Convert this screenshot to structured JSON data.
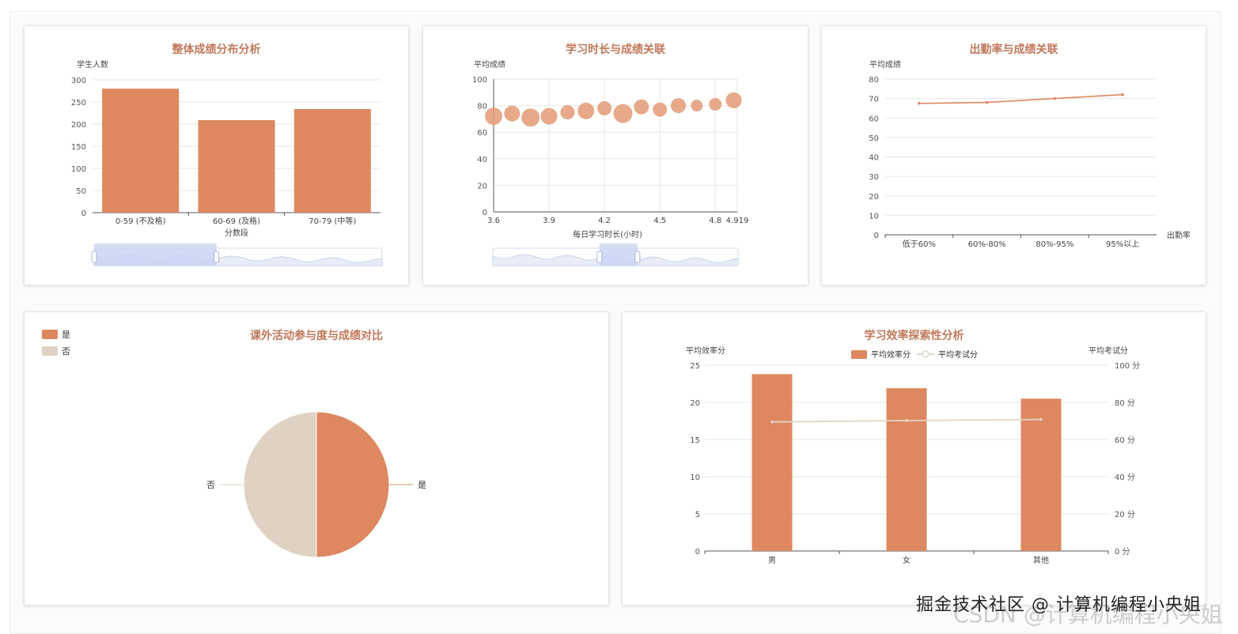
{
  "colors": {
    "bar": "#dd8860",
    "bar_light": "#e39a76",
    "pie_no": "#e0d2c2",
    "title": "#c0785a",
    "line2": "#e3d5c6",
    "axis": "#666666",
    "grid": "#e6e6e6",
    "zoom_fill": "#c9d5f3"
  },
  "chart_data": [
    {
      "id": "score-dist",
      "type": "bar",
      "title": "整体成绩分布分析",
      "xlabel": "分数段",
      "ylabel": "学生人数",
      "categories": [
        "0-59 (不及格)",
        "60-69 (及格)",
        "70-79 (中等)"
      ],
      "values": [
        280,
        209,
        234
      ],
      "ylim": [
        0,
        300
      ],
      "yticks": [
        "0",
        "50",
        "100",
        "150",
        "200",
        "250",
        "300"
      ],
      "grid": true,
      "datazoom": true
    },
    {
      "id": "study-hours",
      "type": "scatter",
      "title": "学习时长与成绩关联",
      "xlabel": "每日学习时长(小时)",
      "ylabel": "平均成绩",
      "xlim": [
        3.6,
        4.919
      ],
      "ylim": [
        0,
        100
      ],
      "xticks": [
        "3.6",
        "3.9",
        "4.2",
        "4.5",
        "4.8",
        "4.919"
      ],
      "yticks": [
        "0",
        "20",
        "40",
        "60",
        "80",
        "100"
      ],
      "points": [
        {
          "x": 3.6,
          "y": 72,
          "size": 22
        },
        {
          "x": 3.7,
          "y": 74,
          "size": 20
        },
        {
          "x": 3.8,
          "y": 71,
          "size": 23
        },
        {
          "x": 3.9,
          "y": 72,
          "size": 21
        },
        {
          "x": 4.0,
          "y": 75,
          "size": 18
        },
        {
          "x": 4.1,
          "y": 76,
          "size": 21
        },
        {
          "x": 4.2,
          "y": 78,
          "size": 18
        },
        {
          "x": 4.3,
          "y": 74,
          "size": 24
        },
        {
          "x": 4.4,
          "y": 79,
          "size": 19
        },
        {
          "x": 4.5,
          "y": 77,
          "size": 18
        },
        {
          "x": 4.6,
          "y": 80,
          "size": 19
        },
        {
          "x": 4.7,
          "y": 80,
          "size": 15
        },
        {
          "x": 4.8,
          "y": 81,
          "size": 16
        },
        {
          "x": 4.9,
          "y": 84,
          "size": 20
        }
      ],
      "grid": true,
      "datazoom": true
    },
    {
      "id": "attendance",
      "type": "line",
      "title": "出勤率与成绩关联",
      "xlabel": "出勤率",
      "ylabel": "平均成绩",
      "categories": [
        "低于60%",
        "60%-80%",
        "80%-95%",
        "95%以上"
      ],
      "values": [
        67.5,
        68,
        70,
        72
      ],
      "ylim": [
        0,
        80
      ],
      "yticks": [
        "0",
        "10",
        "20",
        "30",
        "40",
        "50",
        "60",
        "70",
        "80"
      ],
      "grid": true
    },
    {
      "id": "activities",
      "type": "pie",
      "title": "课外活动参与度与成绩对比",
      "slices": [
        {
          "name": "是",
          "value": 50
        },
        {
          "name": "否",
          "value": 50
        }
      ],
      "legend": "top-left"
    },
    {
      "id": "efficiency",
      "type": "bar",
      "title": "学习效率探索性分析",
      "categories": [
        "男",
        "女",
        "其他"
      ],
      "ylabel": "平均效率分",
      "y2label": "平均考试分",
      "ylim": [
        0,
        25
      ],
      "y2lim": [
        0,
        100
      ],
      "yticks": [
        "0",
        "5",
        "10",
        "15",
        "20",
        "25"
      ],
      "y2ticks": [
        "0 分",
        "20 分",
        "40 分",
        "60 分",
        "80 分",
        "100 分"
      ],
      "series": [
        {
          "name": "平均效率分",
          "type": "bar",
          "values": [
            23.8,
            21.9,
            20.5
          ]
        },
        {
          "name": "平均考试分",
          "type": "line",
          "values": [
            69.5,
            70.2,
            70.8
          ]
        }
      ],
      "legend": "top-center",
      "grid": true
    }
  ],
  "watermark": {
    "text": "掘金技术社区 @ 计算机编程小央姐",
    "faint": "CSDN @计算机编程小央姐"
  }
}
